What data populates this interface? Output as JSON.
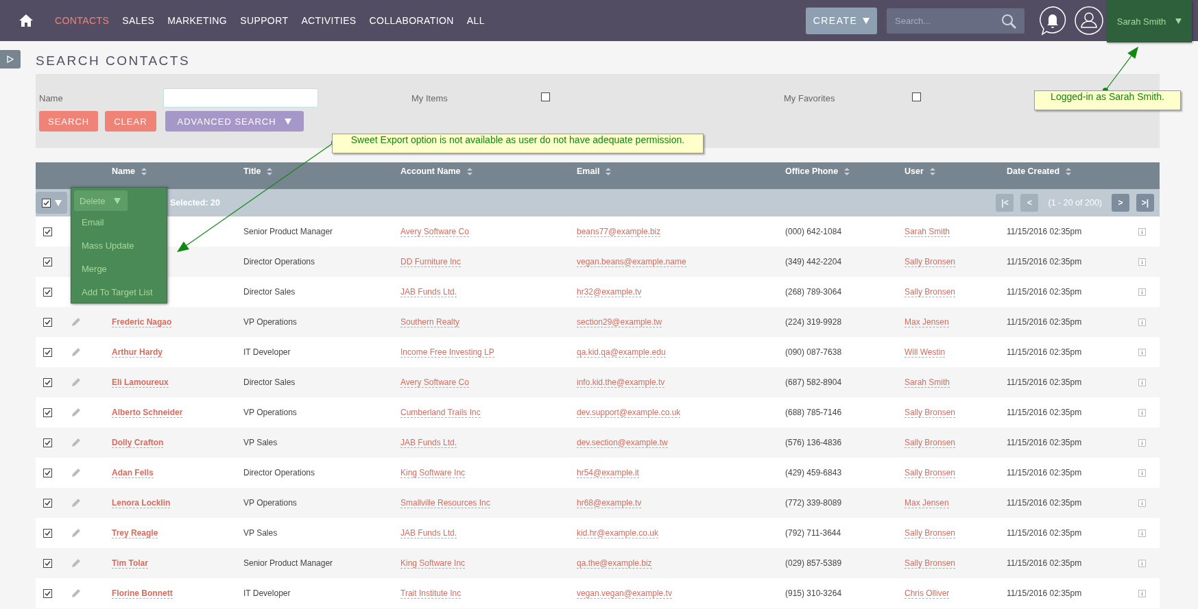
{
  "nav": {
    "tabs": [
      {
        "label": "CONTACTS",
        "selected": true
      },
      {
        "label": "SALES",
        "selected": false
      },
      {
        "label": "MARKETING",
        "selected": false
      },
      {
        "label": "SUPPORT",
        "selected": false
      },
      {
        "label": "ACTIVITIES",
        "selected": false
      },
      {
        "label": "COLLABORATION",
        "selected": false
      },
      {
        "label": "ALL",
        "selected": false
      }
    ],
    "create_button": "CREATE",
    "search": {
      "placeholder": "Search..."
    },
    "user": {
      "name": "Sarah Smith"
    }
  },
  "page_title": "SEARCH CONTACTS",
  "search_form": {
    "name_label": "Name",
    "my_items": {
      "label": "My Items",
      "checked": false
    },
    "my_favorites": {
      "label": "My Favorites",
      "checked": false
    },
    "buttons": [
      "SEARCH",
      "CLEAR"
    ],
    "advanced_button": "ADVANCED SEARCH"
  },
  "table": {
    "columns": [
      "Name",
      "Title",
      "Account Name",
      "Email",
      "Office Phone",
      "User",
      "Date Created"
    ],
    "bulk_select": {
      "checked": true
    },
    "action_menu": {
      "button": "Delete",
      "items": [
        "Email",
        "Mass Update",
        "Merge",
        "Add To Target List"
      ]
    },
    "selected_count": "Selected: 20",
    "pagination": {
      "back": [
        {
          "label": "|<",
          "disabled": true
        },
        {
          "label": "<",
          "disabled": true
        }
      ],
      "range": "(1 - 20 of 200)",
      "forward": [
        {
          "label": ">",
          "disabled": false
        },
        {
          "label": ">|",
          "disabled": false
        }
      ]
    },
    "rows": [
      {
        "checked": true,
        "title": "Senior Product Manager",
        "account": "Avery Software Co",
        "email": "beans77@example.biz",
        "phone": "(000) 642-1084",
        "user": "Sarah Smith",
        "date": "11/15/2016 02:35pm"
      },
      {
        "checked": true,
        "title": "Director Operations",
        "account": "DD Furniture Inc",
        "email": "vegan.beans@example.name",
        "phone": "(349) 442-2204",
        "user": "Sally Bronsen",
        "date": "11/15/2016 02:35pm"
      },
      {
        "checked": true,
        "title": "Director Sales",
        "account": "JAB Funds Ltd.",
        "email": "hr32@example.tv",
        "phone": "(268) 789-3064",
        "user": "Sally Bronsen",
        "date": "11/15/2016 02:35pm"
      },
      {
        "checked": true,
        "name": "Frederic Nagao",
        "title": "VP Operations",
        "account": "Southern Realty",
        "email": "section29@example.tw",
        "phone": "(224) 319-9928",
        "user": "Max Jensen",
        "date": "11/15/2016 02:35pm"
      },
      {
        "checked": true,
        "name": "Arthur Hardy",
        "title": "IT Developer",
        "account": "Income Free Investing LP",
        "email": "qa.kid.qa@example.edu",
        "phone": "(090) 087-7638",
        "user": "Will Westin",
        "date": "11/15/2016 02:35pm"
      },
      {
        "checked": true,
        "name": "Eli Lamoureux",
        "title": "Director Sales",
        "account": "Avery Software Co",
        "email": "info.kid.the@example.tv",
        "phone": "(687) 582-8904",
        "user": "Sarah Smith",
        "date": "11/15/2016 02:35pm"
      },
      {
        "checked": true,
        "name": "Alberto Schneider",
        "title": "VP Operations",
        "account": "Cumberland Trails Inc",
        "email": "dev.support@example.co.uk",
        "phone": "(688) 785-7146",
        "user": "Sally Bronsen",
        "date": "11/15/2016 02:35pm"
      },
      {
        "checked": true,
        "name": "Dolly Crafton",
        "title": "VP Sales",
        "account": "JAB Funds Ltd.",
        "email": "dev.section@example.tw",
        "phone": "(576) 136-4836",
        "user": "Sally Bronsen",
        "date": "11/15/2016 02:35pm"
      },
      {
        "checked": true,
        "name": "Adan Fells",
        "title": "Director Operations",
        "account": "King Software Inc",
        "email": "hr54@example.it",
        "phone": "(429) 459-6843",
        "user": "Sally Bronsen",
        "date": "11/15/2016 02:35pm"
      },
      {
        "checked": true,
        "name": "Lenora Locklin",
        "title": "VP Operations",
        "account": "Smallville Resources Inc",
        "email": "hr68@example.tv",
        "phone": "(772) 339-8089",
        "user": "Max Jensen",
        "date": "11/15/2016 02:35pm"
      },
      {
        "checked": true,
        "name": "Trey Reagle",
        "title": "VP Sales",
        "account": "JAB Funds Ltd.",
        "email": "kid.hr@example.co.uk",
        "phone": "(792) 711-3644",
        "user": "Sally Bronsen",
        "date": "11/15/2016 02:35pm"
      },
      {
        "checked": true,
        "name": "Tim Tolar",
        "title": "Senior Product Manager",
        "account": "King Software Inc",
        "email": "qa.the@example.biz",
        "phone": "(029) 857-5389",
        "user": "Sally Bronsen",
        "date": "11/15/2016 02:35pm"
      },
      {
        "checked": true,
        "name": "Florine Bonnett",
        "title": "IT Developer",
        "account": "Trait Institute Inc",
        "email": "vegan.vegan@example.tv",
        "phone": "(915) 310-3264",
        "user": "Chris Olliver",
        "date": "11/15/2016 02:35pm"
      }
    ]
  },
  "annotations": [
    {
      "text": "Sweet Export option is not available as user do not have adequate permission."
    },
    {
      "text": "Logged-in as Sarah Smith."
    }
  ]
}
